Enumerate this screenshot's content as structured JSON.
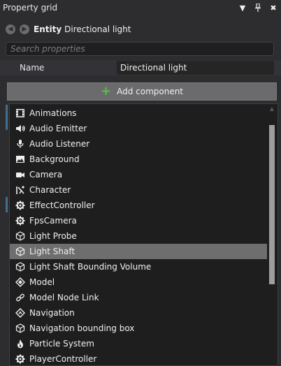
{
  "window": {
    "title": "Property grid",
    "menu_icon": "triangle-down-icon",
    "pin_icon": "pin-icon",
    "close_icon": "close-icon"
  },
  "entity": {
    "label": "Entity",
    "name": "Directional light"
  },
  "search": {
    "placeholder": "Search properties"
  },
  "name_row": {
    "key": "Name",
    "value": "Directional light"
  },
  "add_component": {
    "label": "Add component",
    "icon": "plus-icon",
    "icon_color": "#57c23a"
  },
  "components": [
    {
      "label": "Animations",
      "icon": "film-icon"
    },
    {
      "label": "Audio Emitter",
      "icon": "speaker-icon"
    },
    {
      "label": "Audio Listener",
      "icon": "microphone-icon"
    },
    {
      "label": "Background",
      "icon": "image-icon"
    },
    {
      "label": "Camera",
      "icon": "camera-icon"
    },
    {
      "label": "Character",
      "icon": "character-icon"
    },
    {
      "label": "EffectController",
      "icon": "gear-icon"
    },
    {
      "label": "FpsCamera",
      "icon": "gear-icon"
    },
    {
      "label": "Light Probe",
      "icon": "cube-icon"
    },
    {
      "label": "Light Shaft",
      "icon": "cube-icon",
      "selected": true
    },
    {
      "label": "Light Shaft Bounding Volume",
      "icon": "cube-icon"
    },
    {
      "label": "Model",
      "icon": "model-icon"
    },
    {
      "label": "Model Node Link",
      "icon": "link-icon"
    },
    {
      "label": "Navigation",
      "icon": "navigation-icon"
    },
    {
      "label": "Navigation bounding box",
      "icon": "cube-icon"
    },
    {
      "label": "Particle System",
      "icon": "flame-icon"
    },
    {
      "label": "PlayerController",
      "icon": "gear-icon"
    }
  ],
  "colors": {
    "background": "#2d2d30",
    "dropdown_bg": "#1e1e1e",
    "selected_bg": "#6e6e6e",
    "button_bg": "#6b6b6e"
  }
}
